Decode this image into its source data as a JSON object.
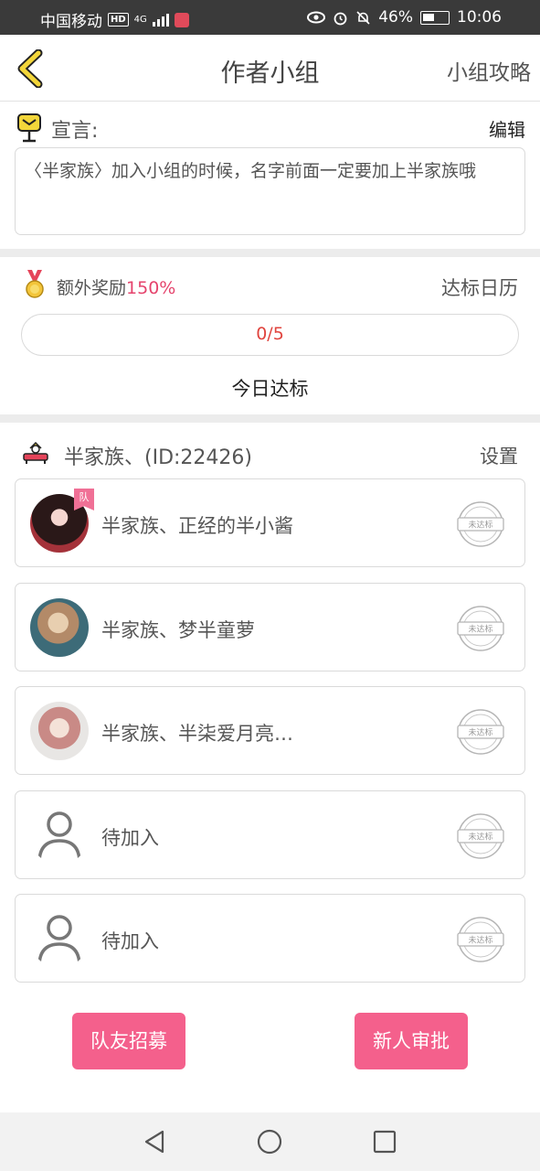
{
  "status_bar": {
    "carrier": "中国移动",
    "hd": "HD",
    "network": "4G",
    "battery": "46%",
    "time": "10:06"
  },
  "header": {
    "title": "作者小组",
    "guide": "小组攻略"
  },
  "manifesto": {
    "label": "宣言:",
    "edit": "编辑",
    "text": "〈半家族〉加入小组的时候，名字前面一定要加上半家族哦"
  },
  "reward": {
    "label": "额外奖励",
    "percent": "150%",
    "calendar": "达标日历",
    "progress_text": "0/5",
    "progress_fraction": 0,
    "today_label": "今日达标"
  },
  "team": {
    "name": "半家族、(ID:22426)",
    "settings": "设置",
    "leader_badge": "队",
    "stamp_text": "未达标",
    "members": [
      {
        "name": "半家族、正经的半小酱",
        "status": "未达标"
      },
      {
        "name": "半家族、梦半童萝",
        "status": "未达标"
      },
      {
        "name": "半家族、半柒爱月亮…",
        "status": "未达标"
      },
      {
        "name": "待加入",
        "status": "未达标"
      },
      {
        "name": "待加入",
        "status": "未达标"
      }
    ]
  },
  "actions": {
    "recruit": "队友招募",
    "approve": "新人审批"
  },
  "colors": {
    "accent_pink": "#f4608c",
    "percent_red": "#e5446d",
    "back_yellow": "#f3d63a"
  }
}
